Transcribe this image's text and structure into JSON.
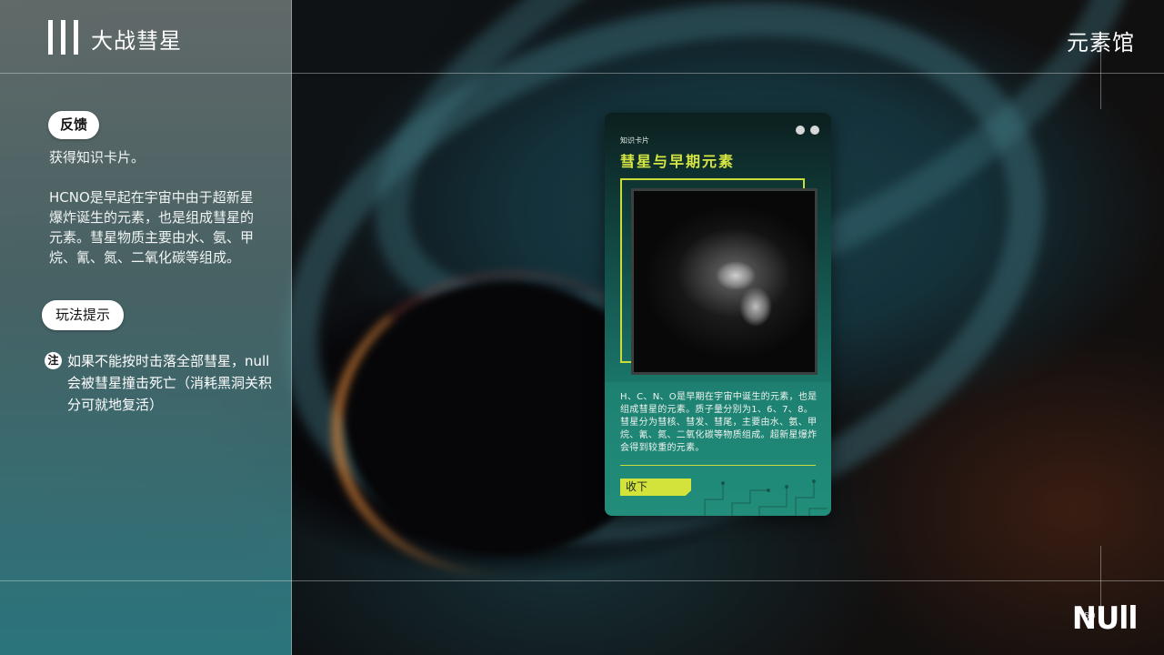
{
  "header": {
    "game_title": "大战彗星",
    "section_title": "元素馆"
  },
  "left_panel": {
    "feedback_label": "反馈",
    "feedback_text": "获得知识卡片。",
    "feedback_body": "HCNO是早起在宇宙中由于超新星爆炸诞生的元素，也是组成彗星的元素。彗星物质主要由水、氨、甲烷、氰、氮、二氧化碳等组成。",
    "tips_label": "玩法提示",
    "note_icon": "注",
    "note_text": "如果不能按时击落全部彗星，null会被彗星撞击死亡（消耗黑洞关积分可就地复活）"
  },
  "card": {
    "kicker": "知识卡片",
    "title": "彗星与早期元素",
    "image_icon": "comet-photo",
    "description": "H、C、N、O是早期在宇宙中诞生的元素，也是组成彗星的元素。质子量分别为1、6、7、8。彗星分为彗核、彗发、彗尾，主要由水、氨、甲烷、氰、氮、二氧化碳等物质组成。超新星爆炸会得到较重的元素。",
    "collapse_label": "收下"
  },
  "footer": {
    "brand": "NUll",
    "page_number": "50"
  },
  "colors": {
    "accent": "#d4e23c",
    "card_title": "#d6e643",
    "panel_teal": "#2e828a"
  }
}
